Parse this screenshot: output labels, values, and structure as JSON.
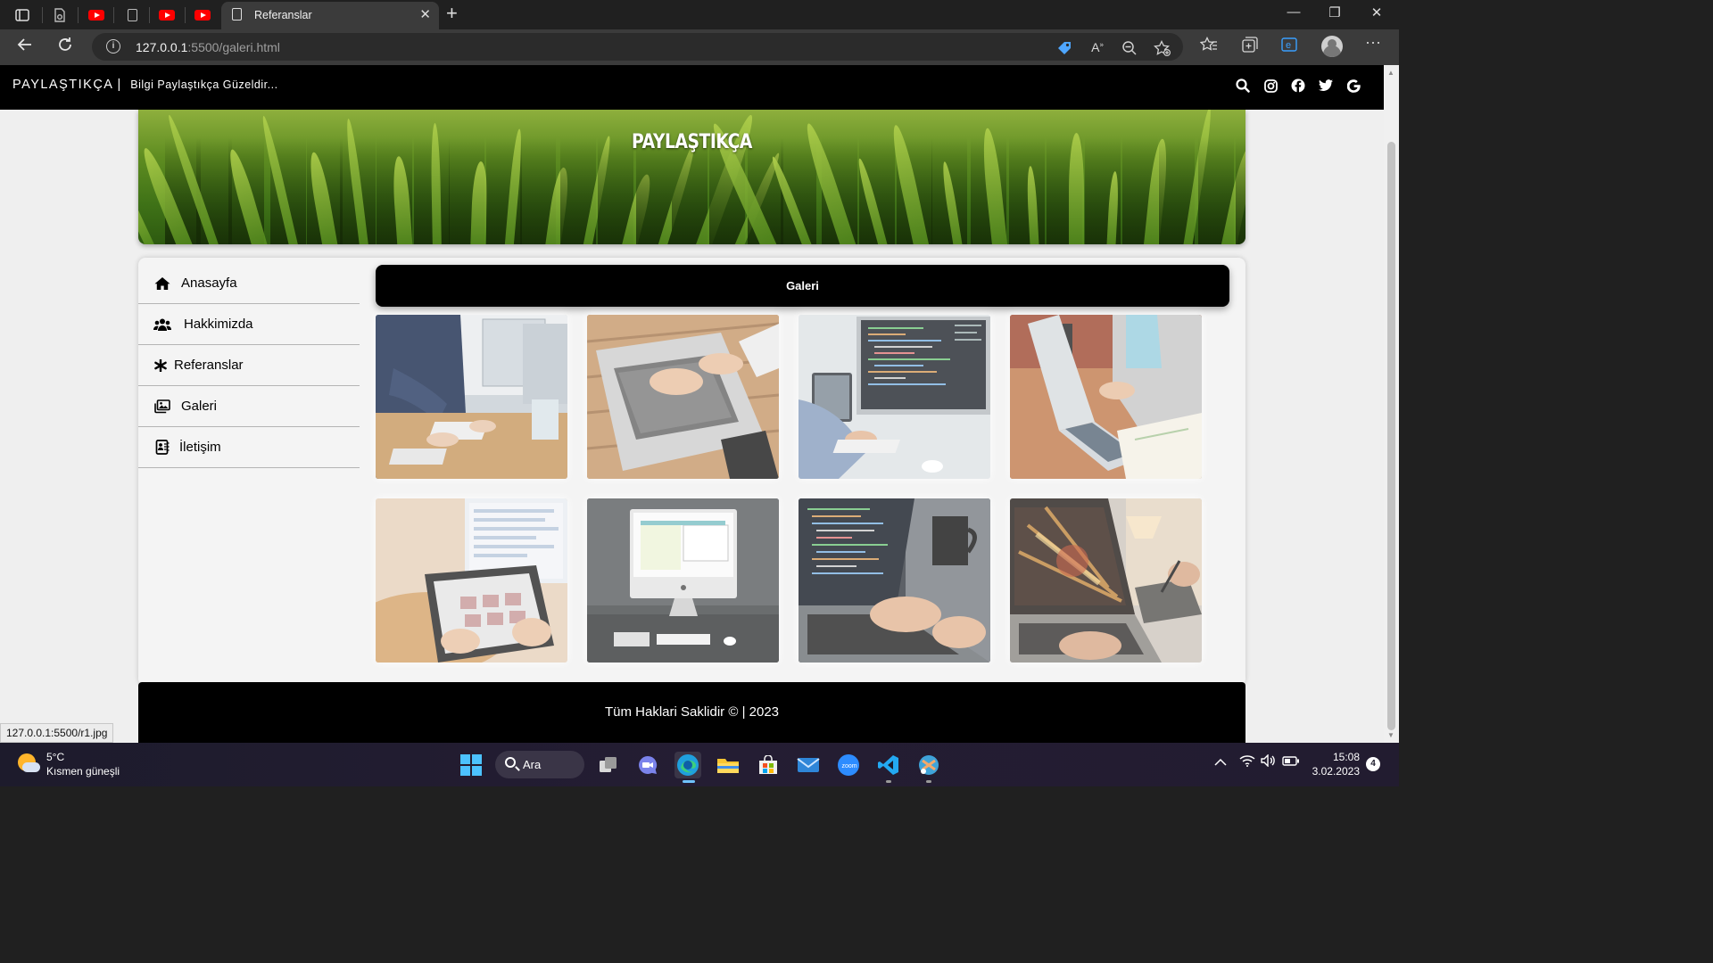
{
  "browser": {
    "tab_title": "Referanslar",
    "url_host": "127.0.0.1",
    "url_path": ":5500/galeri.html"
  },
  "site": {
    "brand": "PAYLAŞTIKÇA",
    "separator": "|",
    "tagline": "Bilgi Paylaştıkça Güzeldir...",
    "social_icons": [
      "search-icon",
      "instagram-icon",
      "facebook-icon",
      "twitter-icon",
      "google-icon"
    ],
    "hero_title": "PAYLAŞTIKÇA"
  },
  "sidebar": {
    "items": [
      {
        "label": "Anasayfa",
        "icon": "home-icon"
      },
      {
        "label": "Hakkimizda",
        "icon": "users-icon"
      },
      {
        "label": "Referanslar",
        "icon": "asterisk-icon"
      },
      {
        "label": "Galeri",
        "icon": "images-icon"
      },
      {
        "label": "İletişim",
        "icon": "contact-card-icon"
      }
    ]
  },
  "main": {
    "section_title": "Galeri",
    "gallery": [
      {
        "name": "office-desk-computers"
      },
      {
        "name": "hands-on-laptop"
      },
      {
        "name": "code-on-monitor"
      },
      {
        "name": "laptop-with-notebook"
      },
      {
        "name": "tablet-hands"
      },
      {
        "name": "imac-desk"
      },
      {
        "name": "coding-laptop-mug"
      },
      {
        "name": "laptop-drawing-tablet"
      }
    ]
  },
  "footer": {
    "text": "Tüm Haklari Saklidir © | 2023"
  },
  "status_url": "127.0.0.1:5500/r1.jpg",
  "taskbar": {
    "temperature": "5°C",
    "weather": "Kısmen güneşli",
    "search_label": "Ara",
    "time": "15:08",
    "date": "3.02.2023",
    "notification_count": "4"
  },
  "colors": {
    "nav_bg": "#000000",
    "page_bg": "#efefef",
    "accent_edge": "#1ba0e8",
    "youtube": "#ff0000"
  }
}
